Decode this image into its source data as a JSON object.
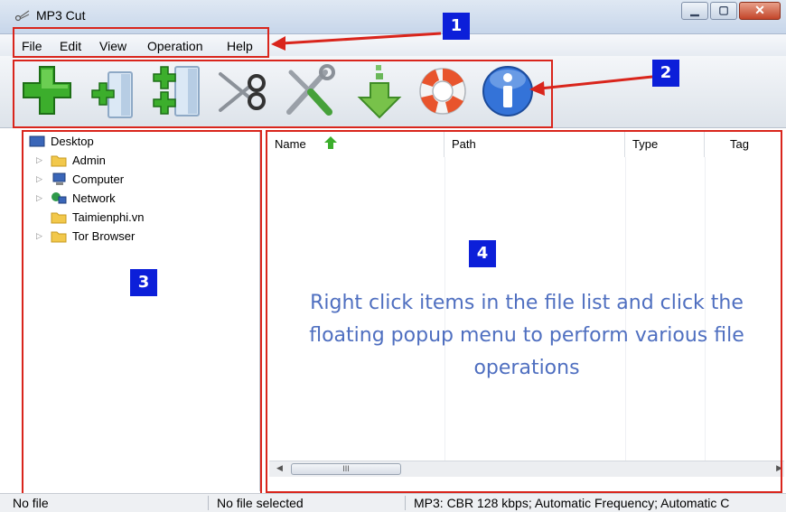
{
  "window": {
    "title": "MP3 Cut",
    "app_icon": "scissors-app-icon"
  },
  "menu": [
    "File",
    "Edit",
    "View",
    "Operation",
    "Help"
  ],
  "toolbar": {
    "buttons": [
      {
        "icon": "plus-icon"
      },
      {
        "icon": "add-file-icon"
      },
      {
        "icon": "add-column-icon"
      },
      {
        "icon": "scissors-icon"
      },
      {
        "icon": "tools-icon"
      },
      {
        "icon": "download-arrow-icon"
      },
      {
        "icon": "lifebuoy-icon"
      },
      {
        "icon": "info-icon"
      }
    ]
  },
  "tree": {
    "root": "Desktop",
    "items": [
      "Admin",
      "Computer",
      "Network",
      "Taimienphi.vn",
      "Tor Browser"
    ]
  },
  "file_list": {
    "columns": [
      "Name",
      "Path",
      "Type",
      "Tag"
    ],
    "hint_lines": [
      "Right click items in the file list and click the",
      "floating popup menu to perform various file",
      "operations"
    ],
    "scroll_thumb": "III"
  },
  "annotations": {
    "badges": [
      "1",
      "2",
      "3",
      "4"
    ],
    "color": "#d9251c",
    "badge_color": "#0c1fd9"
  },
  "status": {
    "left": "No file",
    "middle": "No file selected",
    "right": "MP3:  CBR 128 kbps; Automatic Frequency; Automatic C"
  }
}
